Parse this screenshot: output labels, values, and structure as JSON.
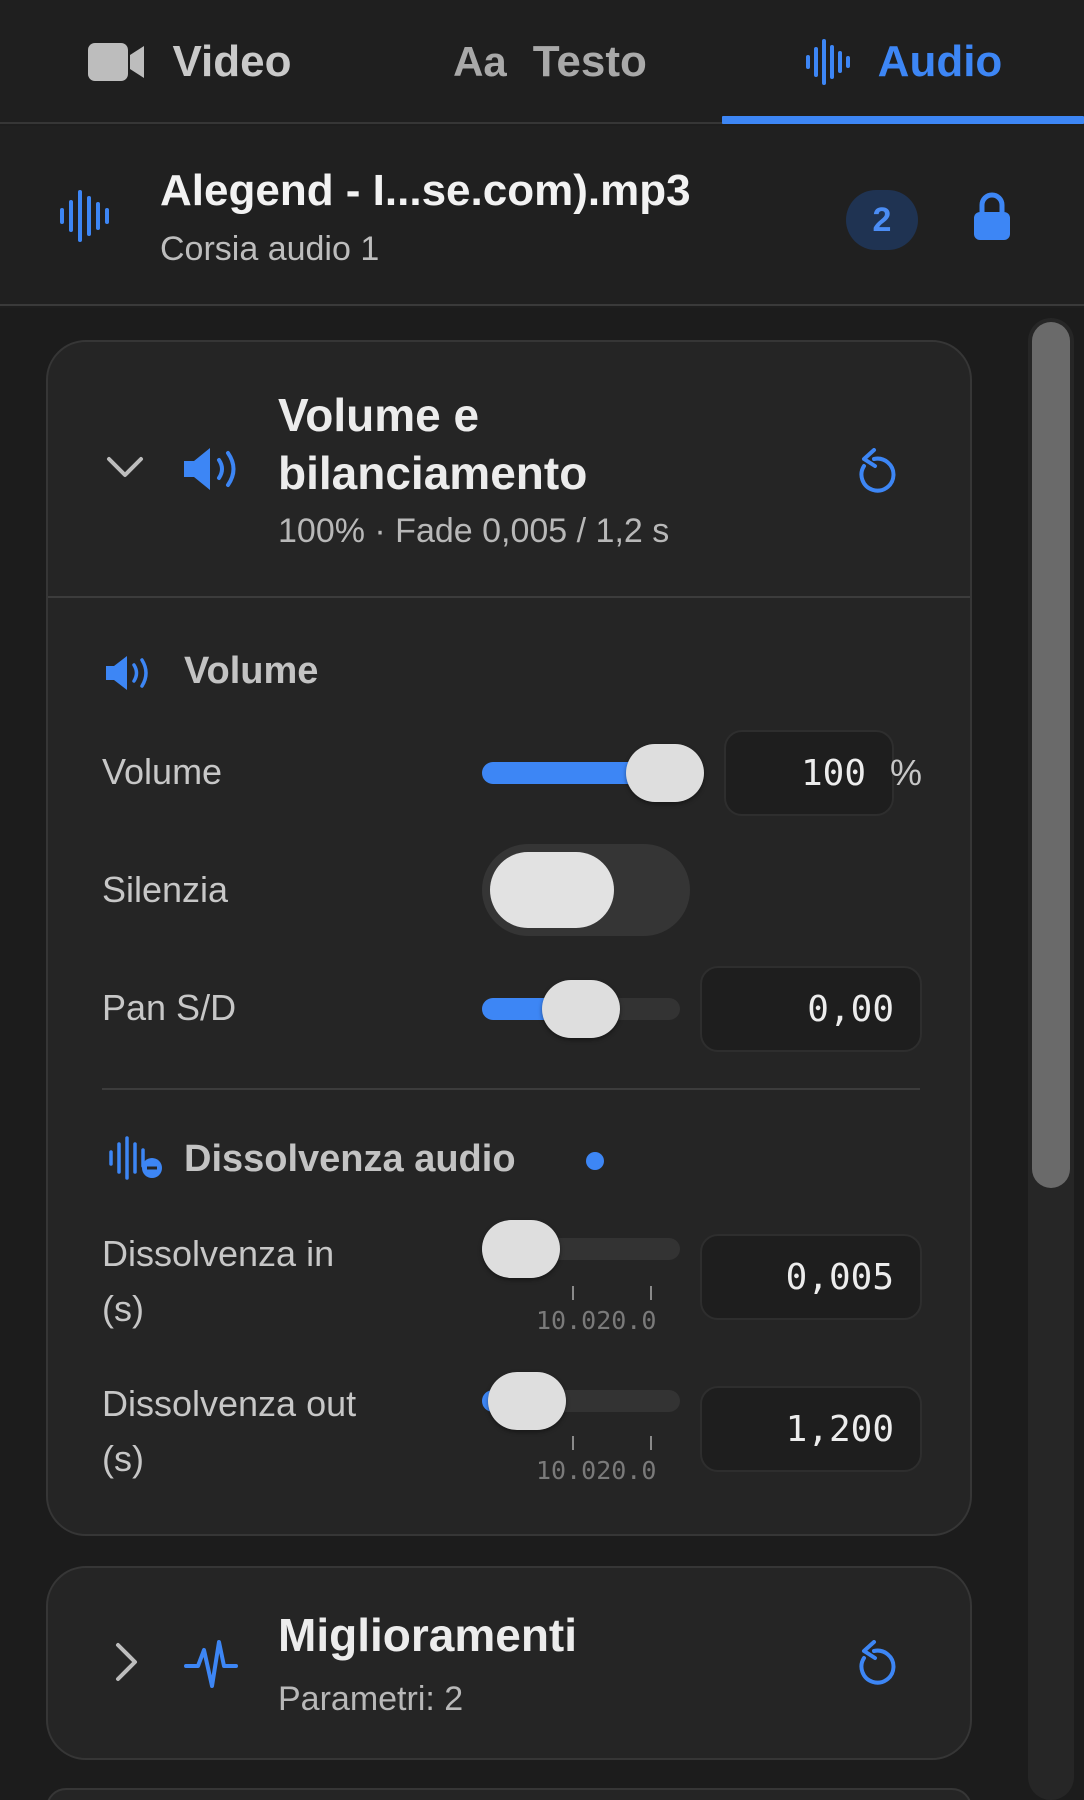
{
  "tabs": [
    {
      "label": "Video",
      "icon": "video-camera-icon",
      "active": false
    },
    {
      "label": "Testo",
      "icon_text": "Aa",
      "active": false
    },
    {
      "label": "Audio",
      "icon": "waveform-icon",
      "active": true
    }
  ],
  "clip": {
    "title": "Alegend - I...se.com).mp3",
    "subtitle": "Corsia audio 1",
    "badge": "2",
    "icon": "waveform-icon",
    "lock_icon": "lock-icon"
  },
  "volume_card": {
    "title_line1": "Volume e",
    "title_line2": "bilanciamento",
    "summary": "100% · Fade 0,005 / 1,2 s",
    "expanded": true,
    "volume_section": {
      "title": "Volume",
      "volume": {
        "label": "Volume",
        "value": "100",
        "unit": "%",
        "level": 1.0
      },
      "mute": {
        "label": "Silenzia",
        "on": false
      },
      "pan": {
        "label": "Pan S/D",
        "value": "0,00",
        "level": 0.5
      }
    },
    "fade_section": {
      "title": "Dissolvenza audio",
      "fade_in": {
        "label_line1": "Dissolvenza in",
        "label_line2": "(s)",
        "value": "0,005",
        "level": 0.0005,
        "tick_labels": "10.020.0"
      },
      "fade_out": {
        "label_line1": "Dissolvenza out",
        "label_line2": "(s)",
        "value": "1,200",
        "level": 0.04,
        "tick_labels": "10.020.0"
      }
    }
  },
  "improvements_card": {
    "title": "Miglioramenti",
    "summary": "Parametri: 2",
    "expanded": false
  },
  "colors": {
    "accent": "#3d86f5",
    "background": "#1e1e1e",
    "card": "#252525"
  }
}
